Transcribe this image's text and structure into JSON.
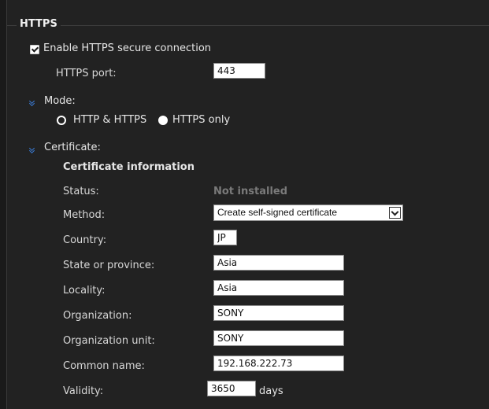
{
  "section": {
    "title": "HTTPS"
  },
  "enable": {
    "label": "Enable HTTPS secure connection",
    "checked": true
  },
  "port": {
    "label": "HTTPS port:",
    "value": "443"
  },
  "mode": {
    "label": "Mode:",
    "options": [
      "HTTP & HTTPS",
      "HTTPS only"
    ],
    "selected": "HTTPS only"
  },
  "certificate": {
    "label": "Certificate:",
    "info_heading": "Certificate information",
    "status": {
      "label": "Status:",
      "value": "Not installed"
    },
    "method": {
      "label": "Method:",
      "value": "Create self-signed certificate"
    },
    "country": {
      "label": "Country:",
      "value": "JP"
    },
    "state": {
      "label": "State or province:",
      "value": "Asia"
    },
    "locality": {
      "label": "Locality:",
      "value": "Asia"
    },
    "organization": {
      "label": "Organization:",
      "value": "SONY"
    },
    "org_unit": {
      "label": "Organization unit:",
      "value": "SONY"
    },
    "common_name": {
      "label": "Common name:",
      "value": "192.168.222.73"
    },
    "validity": {
      "label": "Validity:",
      "value": "3650",
      "unit": "days"
    }
  },
  "colors": {
    "background": "#222222",
    "accent": "#3a7bd5",
    "muted": "#7a7a7a"
  },
  "icons": {
    "expand": "chevron-double-down-icon"
  }
}
